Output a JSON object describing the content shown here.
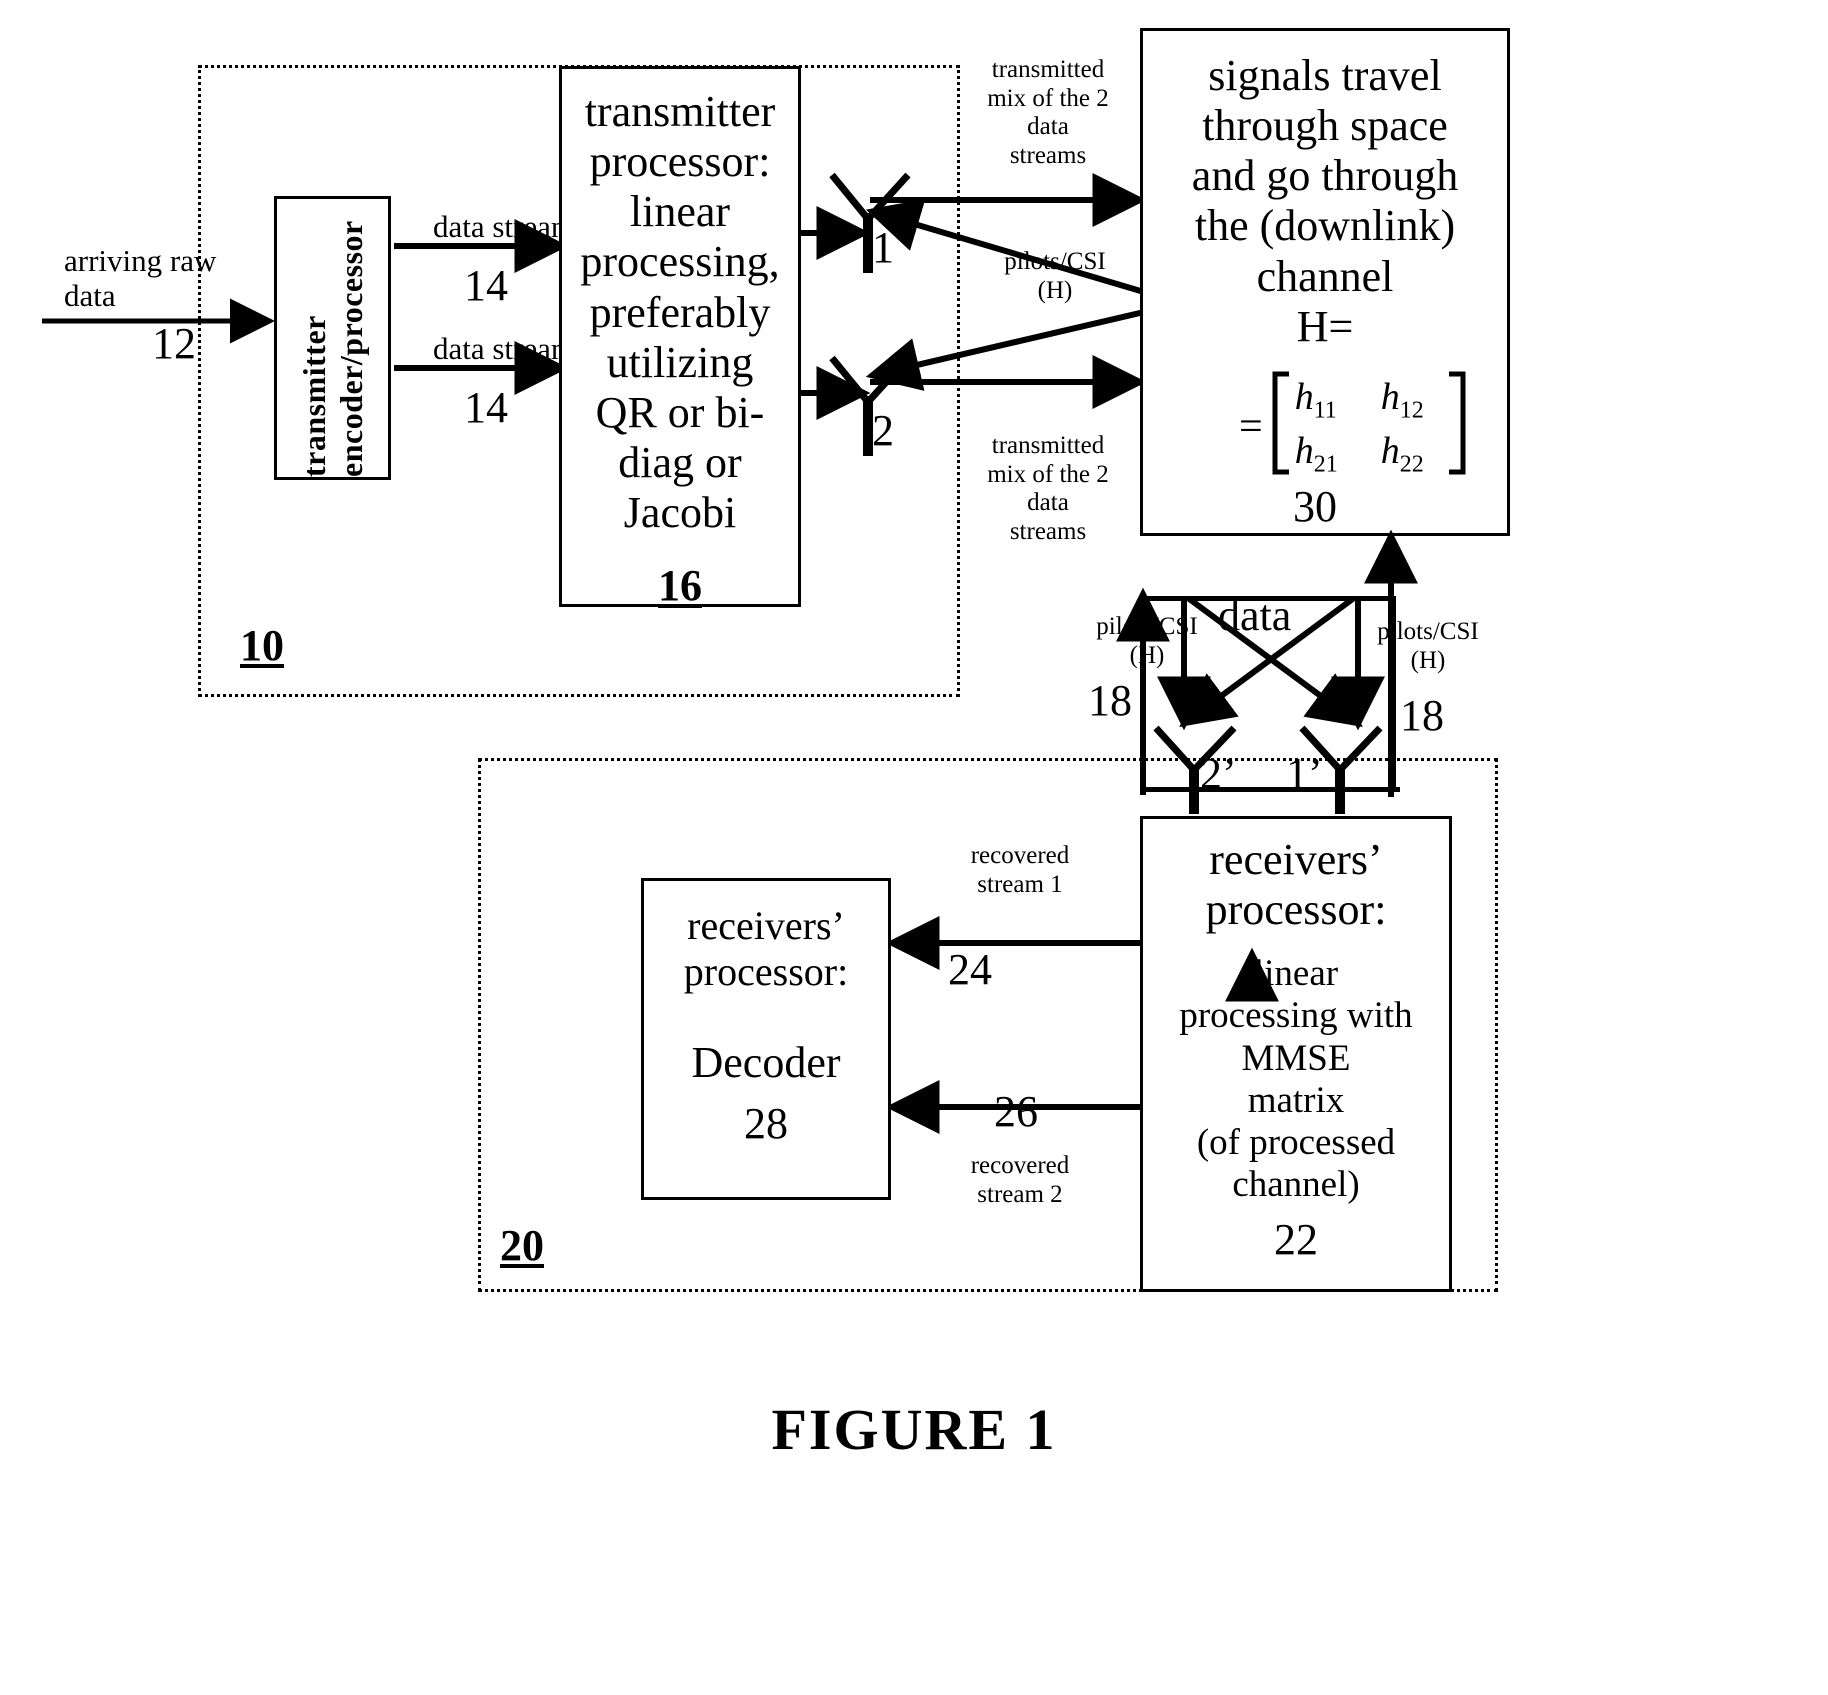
{
  "figure": {
    "caption": "FIGURE 1"
  },
  "transmitter_enclosure": {
    "ref": "10"
  },
  "receiver_enclosure": {
    "ref": "20"
  },
  "blocks": {
    "encoder": {
      "label": "transmitter\nencoder/processor"
    },
    "tx_processor": {
      "label": "transmitter\nprocessor:\nlinear\nprocessing,\npreferably\nutilizing\nQR or bi-\ndiag or\nJacobi",
      "ref": "16"
    },
    "channel": {
      "label": "signals travel\nthrough space\nand go through\nthe (downlink)\nchannel\nH=",
      "matrix": {
        "equals": "=",
        "rows": [
          [
            "h",
            "11",
            "h",
            "12"
          ],
          [
            "h",
            "21",
            "h",
            "22"
          ]
        ],
        "r1c1_base": "h",
        "r1c1_sub": "11",
        "r1c2_base": "h",
        "r1c2_sub": "12",
        "r2c1_base": "h",
        "r2c1_sub": "21",
        "r2c2_base": "h",
        "r2c2_sub": "22"
      },
      "ref": "30"
    },
    "rx_processor": {
      "label_top": "receivers’\nprocessor:",
      "label_body": "linear\nprocessing with\nMMSE\nmatrix\n(of processed\nchannel)",
      "ref": "22"
    },
    "decoder": {
      "label": "receivers’\nprocessor:",
      "name": "Decoder",
      "ref": "28"
    }
  },
  "arrows": {
    "arriving_raw_data": "arriving raw data",
    "arriving_ref": "12",
    "data_stream_1": "data stream",
    "data_stream_1_ref": "14",
    "data_stream_2": "data stream",
    "data_stream_2_ref": "14",
    "tx_mix_top": "transmitted\nmix of the 2\ndata\nstreams",
    "tx_mix_bottom": "transmitted\nmix of the 2\ndata\nstreams",
    "pilots_csi_top": "pilots/CSI\n(H)",
    "pilots_csi_left": "pilots/CSI\n(H)",
    "pilots_csi_right": "pilots/CSI\n(H)",
    "pilots_ref_left": "18",
    "pilots_ref_right": "18",
    "data_label": "data",
    "recovered_stream_1": "recovered\nstream 1",
    "recovered_stream_1_ref": "24",
    "recovered_stream_2": "recovered\nstream 2",
    "recovered_stream_2_ref": "26"
  },
  "antennas": {
    "tx1": "1",
    "tx2": "2",
    "rx2": "2’",
    "rx1": "1’"
  },
  "colors": {
    "ink": "#000000",
    "paper": "#ffffff"
  }
}
